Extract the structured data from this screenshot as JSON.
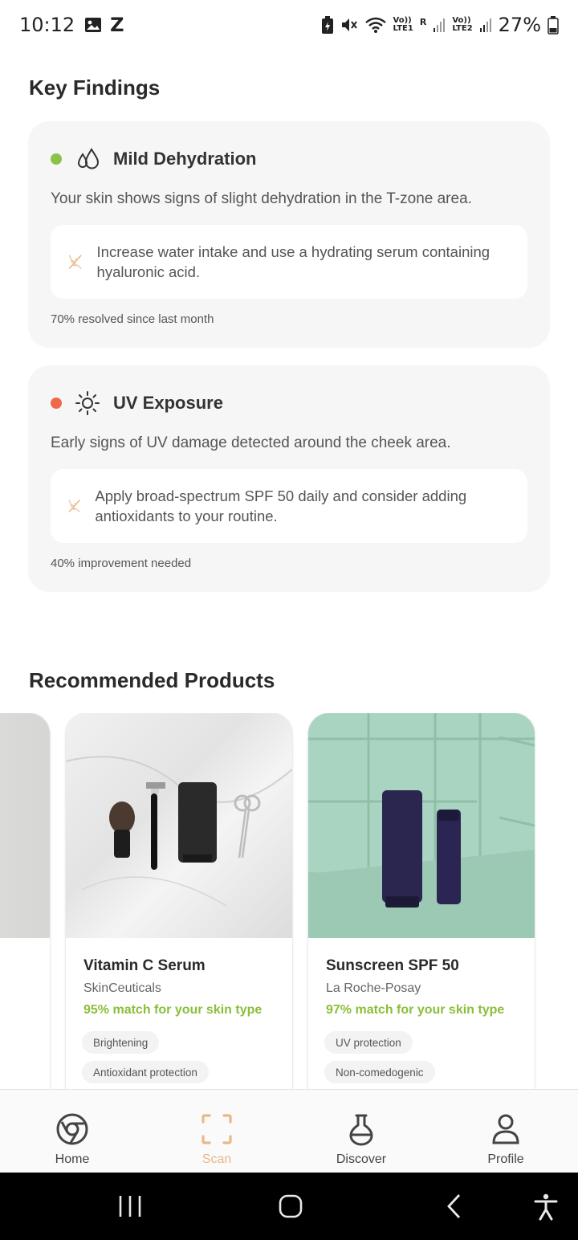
{
  "status_bar": {
    "time": "10:12",
    "notif_letter": "Z",
    "sim1_top": "Vo))",
    "sim1_bottom": "LTE1",
    "sim1_roam": "R",
    "sim2_top": "Vo))",
    "sim2_bottom": "LTE2",
    "battery": "27%"
  },
  "key_findings": {
    "title": "Key Findings",
    "items": [
      {
        "title": "Mild Dehydration",
        "icon": "water-drops-icon",
        "status_color": "#8bc34a",
        "description": "Your skin shows signs of slight dehydration in the T-zone area.",
        "tip": "Increase water intake and use a hydrating serum containing hyaluronic acid.",
        "progress_text": "70% resolved since last month"
      },
      {
        "title": "UV Exposure",
        "icon": "sun-icon",
        "status_color": "#f0684a",
        "description": "Early signs of UV damage detected around the cheek area.",
        "tip": "Apply broad-spectrum SPF 50 daily and consider adding antioxidants to your routine.",
        "progress_text": "40% improvement needed"
      }
    ]
  },
  "recommended": {
    "title": "Recommended Products",
    "products": [
      {
        "name": "Vitamin C Serum",
        "brand": "SkinCeuticals",
        "match": "95% match for your skin type",
        "tags": [
          "Brightening",
          "Antioxidant protection"
        ]
      },
      {
        "name": "Sunscreen SPF 50",
        "brand": "La Roche-Posay",
        "match": "97% match for your skin type",
        "tags": [
          "UV protection",
          "Non-comedogenic"
        ]
      }
    ]
  },
  "nav": {
    "items": [
      {
        "label": "Home",
        "icon": "home-icon"
      },
      {
        "label": "Scan",
        "icon": "scan-icon"
      },
      {
        "label": "Discover",
        "icon": "flask-icon"
      },
      {
        "label": "Profile",
        "icon": "profile-icon"
      }
    ],
    "active": "Scan"
  },
  "colors": {
    "accent": "#e9b889",
    "match_green": "#8bbf3a"
  }
}
